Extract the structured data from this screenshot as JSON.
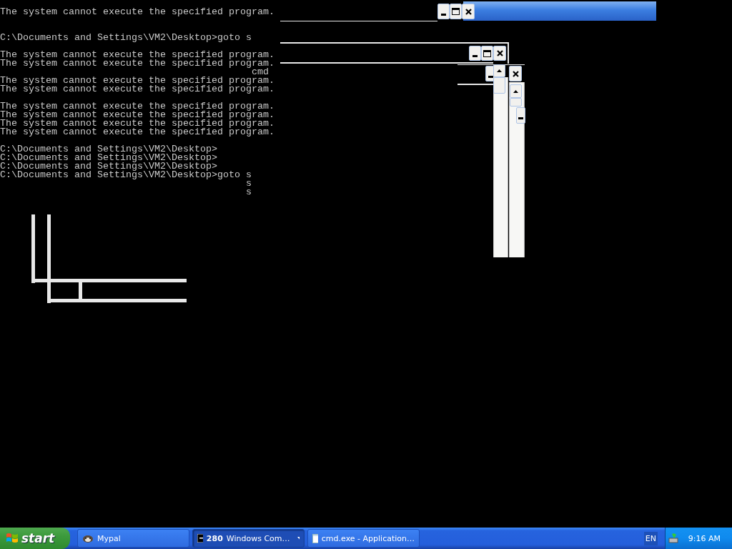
{
  "console": {
    "text": "The system cannot execute the specified program.\n\n\nC:\\Documents and Settings\\VM2\\Desktop>goto s\n\nThe system cannot execute the specified program.\nThe system cannot execute the specified program.\n                                            cmd\nThe system cannot execute the specified program.\nThe system cannot execute the specified program.\n\nThe system cannot execute the specified program.\nThe system cannot execute the specified program.\nThe system cannot execute the specified program.\nThe system cannot execute the specified program.\n\nC:\\Documents and Settings\\VM2\\Desktop>\nC:\\Documents and Settings\\VM2\\Desktop>\nC:\\Documents and Settings\\VM2\\Desktop>\nC:\\Documents and Settings\\VM2\\Desktop>goto s\n                                           s\n                                           s"
  },
  "taskbar": {
    "start_label": "start",
    "buttons": [
      {
        "kind": "app",
        "label": "Mypal",
        "selected": false
      },
      {
        "kind": "group",
        "count": "280",
        "label": "Windows Com…",
        "selected": true
      },
      {
        "kind": "window",
        "label": "cmd.exe - Application…",
        "selected": false
      }
    ],
    "language": "EN",
    "clock": "9:16 AM"
  }
}
